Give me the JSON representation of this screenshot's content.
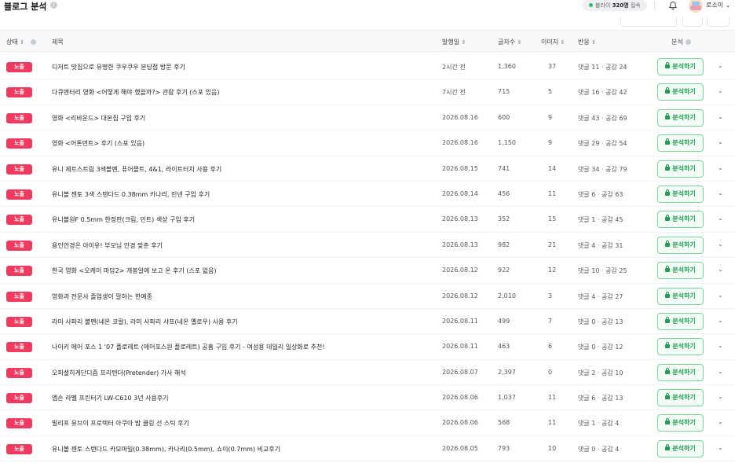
{
  "header": {
    "title": "블로그 분석",
    "visitors": {
      "prefix": "블라이",
      "count": "320명",
      "suffix": "접속"
    },
    "user_name": "로소이"
  },
  "columns": {
    "status": "상태",
    "title": "제목",
    "date": "발행일",
    "chars": "글자수",
    "images": "이미지",
    "reaction": "반응",
    "analysis": "분석"
  },
  "icons": {
    "sort": "sort-icon",
    "info": "info-icon",
    "bell": "bell-icon",
    "chevron": "chevron-down-icon",
    "lock": "lock-icon"
  },
  "colors": {
    "badge": "#ef3b5f",
    "analyze": "#1f9d52",
    "online": "#22c55e"
  },
  "rows": [
    {
      "status": "노출",
      "title": "디저트 맛집으로 유명한 쿠우쿠우 분당점 방문 후기",
      "date": "2시간 전",
      "chars": "1,360",
      "images": "37",
      "reaction": "댓글 11 · 공감 24",
      "action": "분석하기"
    },
    {
      "status": "노출",
      "title": "다큐멘터리 영화 <어떻게 해야 했을까?> 관람 후기 (스포 있음)",
      "date": "7시간 전",
      "chars": "715",
      "images": "5",
      "reaction": "댓글 16 · 공감 42",
      "action": "분석하기"
    },
    {
      "status": "노출",
      "title": "영화 <리바운드> 대본집 구입 후기",
      "date": "2026.08.16",
      "chars": "600",
      "images": "9",
      "reaction": "댓글 43 · 공감 69",
      "action": "분석하기"
    },
    {
      "status": "노출",
      "title": "영화 <어톤먼트> 후기 (스포 있음)",
      "date": "2026.08.16",
      "chars": "1,150",
      "images": "9",
      "reaction": "댓글 29 · 공감 54",
      "action": "분석하기"
    },
    {
      "status": "노출",
      "title": "유니 제트스트림 3색볼펜, 퓨어몰트, 4&1, 라이트터치 사용 후기",
      "date": "2026.08.15",
      "chars": "741",
      "images": "14",
      "reaction": "댓글 34 · 공감 79",
      "action": "분석하기"
    },
    {
      "status": "노출",
      "title": "유니볼 젠토 3색 스탠다드 0.38mm 카나리, 린넨 구입 후기",
      "date": "2026.08.14",
      "chars": "456",
      "images": "11",
      "reaction": "댓글 6 · 공감 63",
      "action": "분석하기"
    },
    {
      "status": "노출",
      "title": "유니볼원F 0.5mm 한정판(크림, 민트) 색상 구입 후기",
      "date": "2026.08.13",
      "chars": "352",
      "images": "15",
      "reaction": "댓글 1 · 공감 45",
      "action": "분석하기"
    },
    {
      "status": "노출",
      "title": "용인안경은 아이유! 부모님 안경 맞춘 후기",
      "date": "2026.08.13",
      "chars": "982",
      "images": "21",
      "reaction": "댓글 4 · 공감 31",
      "action": "분석하기"
    },
    {
      "status": "노출",
      "title": "한국 영화 <오케이 마담2> 개봉일에 보고 온 후기 (스포 없음)",
      "date": "2026.08.12",
      "chars": "922",
      "images": "12",
      "reaction": "댓글 10 · 공감 25",
      "action": "분석하기"
    },
    {
      "status": "노출",
      "title": "영화과 전문사 졸업생이 말하는 한예종",
      "date": "2026.08.12",
      "chars": "2,010",
      "images": "3",
      "reaction": "댓글 4 · 공감 27",
      "action": "분석하기"
    },
    {
      "status": "노출",
      "title": "라미 사파리 볼펜(네온 코랄), 라미 사파리 샤프(네온 옐로우) 사용 후기",
      "date": "2026.08.11",
      "chars": "499",
      "images": "7",
      "reaction": "댓글 0 · 공감 13",
      "action": "분석하기"
    },
    {
      "status": "노출",
      "title": "나이키 에어 포스 1 '07 플로레트 (에어포스원 플로레트) 공홈 구입 후기 - 여성용 데일리 일상화로 추천!",
      "date": "2026.08.11",
      "chars": "463",
      "images": "6",
      "reaction": "댓글 0 · 공감 12",
      "action": "분석하기"
    },
    {
      "status": "노출",
      "title": "오피셜히게단디즘 프리텐더(Pretender) 가사 해석",
      "date": "2026.08.07",
      "chars": "2,397",
      "images": "0",
      "reaction": "댓글 2 · 공감 10",
      "action": "분석하기"
    },
    {
      "status": "노출",
      "title": "엡손 라벨 프린터기 LW-C610 3년 사용후기",
      "date": "2026.08.06",
      "chars": "1,037",
      "images": "11",
      "reaction": "댓글 6 · 공감 13",
      "action": "분석하기"
    },
    {
      "status": "노출",
      "title": "빌리프 유브이 프로텍터 아쿠아 밤 쿨링 선 스틱 후기",
      "date": "2026.08.06",
      "chars": "568",
      "images": "11",
      "reaction": "댓글 1 · 공감 4",
      "action": "분석하기"
    },
    {
      "status": "노출",
      "title": "유니볼 젠토 스탠다드 카모마일(0.38mm), 카나리(0.5mm), 쇼이(0.7mm) 비교후기",
      "date": "2026.08.05",
      "chars": "793",
      "images": "10",
      "reaction": "댓글 0 · 공감 4",
      "action": "분석하기"
    }
  ]
}
